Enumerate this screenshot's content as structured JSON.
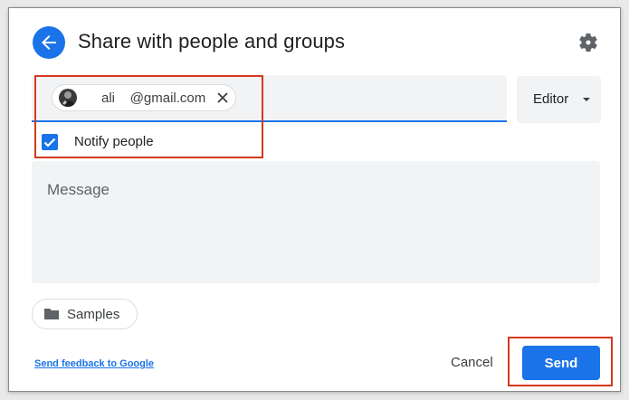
{
  "dialog": {
    "title": "Share with people and groups",
    "back_icon": "arrow-left-icon",
    "settings_icon": "gear-icon"
  },
  "recipients": [
    {
      "name": "ali",
      "email": "@gmail.com",
      "avatar_icon": "user-avatar",
      "remove_icon": "close-icon"
    }
  ],
  "role": {
    "selected": "Editor",
    "icon": "caret-down-icon"
  },
  "notify": {
    "label": "Notify people",
    "checked": true
  },
  "message": {
    "placeholder": "Message"
  },
  "samples_chip": {
    "label": "Samples",
    "icon": "folder-icon"
  },
  "footer": {
    "feedback_link": "Send feedback to Google",
    "cancel_label": "Cancel",
    "send_label": "Send"
  },
  "colors": {
    "accent": "#1a73e8",
    "highlight": "#d5391f",
    "field_bg": "#f1f3f4"
  }
}
